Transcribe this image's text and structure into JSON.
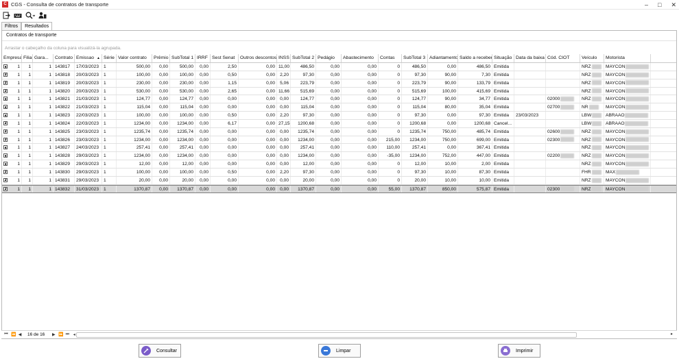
{
  "window": {
    "title": "CGS - Consulta de contratos de transporte",
    "icon_label": "C"
  },
  "tabs": [
    "Filtros",
    "Resultados"
  ],
  "group": {
    "title": "Contratos de transporte",
    "hint": "Arrastar o cabeçalho da coluna para visualizá-la agrupada."
  },
  "columns": [
    "Empresa",
    "Filial",
    "Gara...",
    "Contrato",
    "Emissao",
    "Série",
    "Valor contrato",
    "Prêmio",
    "SubTotal 1",
    "IRRF",
    "Sest Senat",
    "Outros descontos",
    "INSS",
    "SubTotal 2",
    "Pedágio",
    "Abastecimento",
    "Contas",
    "SubTotal 3",
    "Adiantamento",
    "Saldo a receber",
    "Situação",
    "Data da baixa",
    "Cód. CIOT",
    "Veículo",
    "Motorista"
  ],
  "sort_indicator": "▲",
  "rows": [
    [
      "1",
      "1",
      "1",
      "143817",
      "17/03/2023",
      "1",
      "500,00",
      "0,00",
      "500,00",
      "0,00",
      "2,50",
      "0,00",
      "11,00",
      "486,50",
      "0,00",
      "0,00",
      "0",
      "486,50",
      "0,00",
      "486,50",
      "Emitida",
      "",
      "",
      "NRZ",
      "MAYCON"
    ],
    [
      "1",
      "1",
      "1",
      "143818",
      "20/03/2023",
      "1",
      "100,00",
      "0,00",
      "100,00",
      "0,00",
      "0,50",
      "0,00",
      "2,20",
      "97,30",
      "0,00",
      "0,00",
      "0",
      "97,30",
      "90,00",
      "7,30",
      "Emitida",
      "",
      "",
      "NRZ",
      "MAYCON"
    ],
    [
      "1",
      "1",
      "1",
      "143819",
      "20/03/2023",
      "1",
      "230,00",
      "0,00",
      "230,00",
      "0,00",
      "1,15",
      "0,00",
      "5,06",
      "223,79",
      "0,00",
      "0,00",
      "0",
      "223,79",
      "90,00",
      "133,79",
      "Emitida",
      "",
      "",
      "NRZ",
      "MAYCON"
    ],
    [
      "1",
      "1",
      "1",
      "143820",
      "20/03/2023",
      "1",
      "530,00",
      "0,00",
      "530,00",
      "0,00",
      "2,65",
      "0,00",
      "11,66",
      "515,69",
      "0,00",
      "0,00",
      "0",
      "515,69",
      "100,00",
      "415,69",
      "Emitida",
      "",
      "",
      "NRZ",
      "MAYCON"
    ],
    [
      "1",
      "1",
      "1",
      "143821",
      "21/03/2023",
      "1",
      "124,77",
      "0,00",
      "124,77",
      "0,00",
      "0,00",
      "0,00",
      "0,00",
      "124,77",
      "0,00",
      "0,00",
      "0",
      "124,77",
      "90,00",
      "34,77",
      "Emitida",
      "",
      "02000",
      "NRZ",
      "MAYCON"
    ],
    [
      "1",
      "1",
      "1",
      "143822",
      "21/03/2023",
      "1",
      "115,04",
      "0,00",
      "115,04",
      "0,00",
      "0,00",
      "0,00",
      "0,00",
      "115,04",
      "0,00",
      "0,00",
      "0",
      "115,04",
      "80,00",
      "35,04",
      "Emitida",
      "",
      "02700",
      "NR",
      "MAYCON"
    ],
    [
      "1",
      "1",
      "1",
      "143823",
      "22/03/2023",
      "1",
      "100,00",
      "0,00",
      "100,00",
      "0,00",
      "0,50",
      "0,00",
      "2,20",
      "97,30",
      "0,00",
      "0,00",
      "0",
      "97,30",
      "0,00",
      "97,30",
      "Emitida",
      "23/03/2023",
      "",
      "LBW",
      "ABRAAO"
    ],
    [
      "1",
      "1",
      "1",
      "143824",
      "22/03/2023",
      "1",
      "1234,00",
      "0,00",
      "1234,00",
      "0,00",
      "6,17",
      "0,00",
      "27,15",
      "1200,68",
      "0,00",
      "0,00",
      "0",
      "1200,68",
      "0,00",
      "1200,68",
      "Cancel...",
      "",
      "",
      "LBW",
      "ABRAAO"
    ],
    [
      "1",
      "1",
      "1",
      "143825",
      "23/03/2023",
      "1",
      "1235,74",
      "0,00",
      "1235,74",
      "0,00",
      "0,00",
      "0,00",
      "0,00",
      "1235,74",
      "0,00",
      "0,00",
      "0",
      "1235,74",
      "750,00",
      "485,74",
      "Emitida",
      "",
      "02600",
      "NRZ",
      "MAYCON"
    ],
    [
      "1",
      "1",
      "1",
      "143826",
      "23/03/2023",
      "1",
      "1234,00",
      "0,00",
      "1234,00",
      "0,00",
      "0,00",
      "0,00",
      "0,00",
      "1234,00",
      "0,00",
      "0,00",
      "215,00",
      "1234,00",
      "750,00",
      "699,00",
      "Emitida",
      "",
      "02300",
      "NRZ",
      "MAYCON"
    ],
    [
      "1",
      "1",
      "1",
      "143827",
      "24/03/2023",
      "1",
      "257,41",
      "0,00",
      "257,41",
      "0,00",
      "0,00",
      "0,00",
      "0,00",
      "257,41",
      "0,00",
      "0,00",
      "110,00",
      "257,41",
      "0,00",
      "367,41",
      "Emitida",
      "",
      "",
      "NRZ",
      "MAYCON"
    ],
    [
      "1",
      "1",
      "1",
      "143828",
      "29/03/2023",
      "1",
      "1234,00",
      "0,00",
      "1234,00",
      "0,00",
      "0,00",
      "0,00",
      "0,00",
      "1234,00",
      "0,00",
      "0,00",
      "-35,00",
      "1234,00",
      "752,00",
      "447,00",
      "Emitida",
      "",
      "02200",
      "NRZ",
      "MAYCON"
    ],
    [
      "1",
      "1",
      "1",
      "143829",
      "29/03/2023",
      "1",
      "12,00",
      "0,00",
      "12,00",
      "0,00",
      "0,00",
      "0,00",
      "0,00",
      "12,00",
      "0,00",
      "0,00",
      "0",
      "12,00",
      "10,00",
      "2,00",
      "Emitida",
      "",
      "",
      "NRZ",
      "MAYCON"
    ],
    [
      "1",
      "1",
      "1",
      "143830",
      "29/03/2023",
      "1",
      "100,00",
      "0,00",
      "100,00",
      "0,00",
      "0,50",
      "0,00",
      "2,20",
      "97,30",
      "0,00",
      "0,00",
      "0",
      "97,30",
      "10,00",
      "87,30",
      "Emitida",
      "",
      "",
      "FHR",
      "MAX"
    ],
    [
      "1",
      "1",
      "1",
      "143831",
      "29/03/2023",
      "1",
      "20,00",
      "0,00",
      "20,00",
      "0,00",
      "0,00",
      "0,00",
      "0,00",
      "20,00",
      "0,00",
      "0,00",
      "0",
      "20,00",
      "10,00",
      "10,00",
      "Emitida",
      "",
      "",
      "NRZ",
      "MAYCON"
    ],
    [
      "1",
      "1",
      "1",
      "143832",
      "31/03/2023",
      "1",
      "1370,87",
      "0,00",
      "1370,87",
      "0,00",
      "0,00",
      "0,00",
      "0,00",
      "1370,87",
      "0,00",
      "0,00",
      "55,00",
      "1370,87",
      "850,00",
      "575,87",
      "Emitida",
      "",
      "02300",
      "NRZ",
      "MAYCON"
    ]
  ],
  "selected_row": 15,
  "pager": {
    "text": "16 de 16"
  },
  "buttons": {
    "consultar": "Consultar",
    "limpar": "Limpar",
    "imprimir": "Imprimir"
  },
  "colors": {
    "accent_consultar": "#7b5cc9",
    "accent_limpar": "#3a78d8",
    "accent_imprimir": "#8a6ed1",
    "selected_row": "#d8d8d8"
  }
}
